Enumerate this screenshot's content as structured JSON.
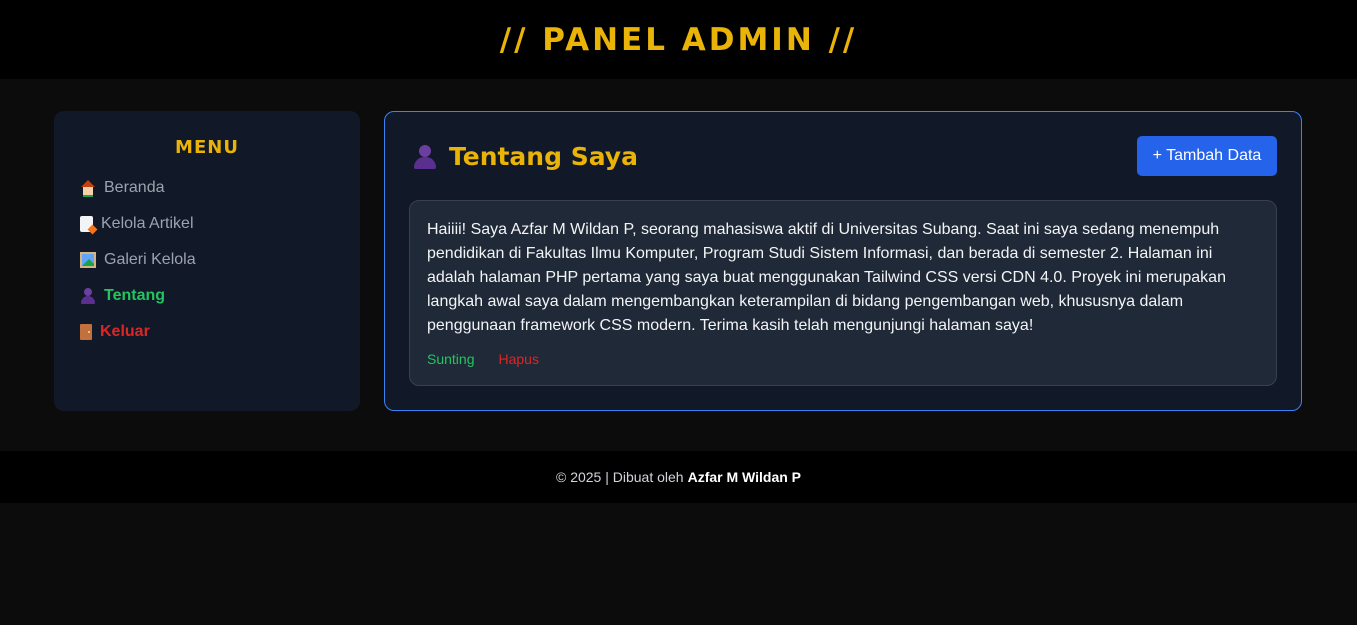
{
  "header": {
    "title": "// PANEL ADMIN //"
  },
  "sidebar": {
    "title": "MENU",
    "items": [
      {
        "icon": "house-icon",
        "label": "Beranda"
      },
      {
        "icon": "memo-icon",
        "label": "Kelola Artikel"
      },
      {
        "icon": "picture-icon",
        "label": "Galeri Kelola"
      },
      {
        "icon": "user-icon",
        "label": "Tentang",
        "active": true
      },
      {
        "icon": "door-icon",
        "label": "Keluar"
      }
    ]
  },
  "main": {
    "icon": "user-icon",
    "title": "Tentang Saya",
    "add_button": "+ Tambah Data",
    "card": {
      "text": "Haiiii! Saya Azfar M Wildan P, seorang mahasiswa aktif di Universitas Subang. Saat ini saya sedang menempuh pendidikan di Fakultas Ilmu Komputer, Program Studi Sistem Informasi, dan berada di semester 2. Halaman ini adalah halaman PHP pertama yang saya buat menggunakan Tailwind CSS versi CDN 4.0. Proyek ini merupakan langkah awal saya dalam mengembangkan keterampilan di bidang pengembangan web, khususnya dalam penggunaan framework CSS modern. Terima kasih telah mengunjungi halaman saya!",
      "edit_label": "Sunting",
      "delete_label": "Hapus"
    }
  },
  "footer": {
    "text": "© 2025 | Dibuat oleh",
    "author": "Azfar M Wildan P"
  },
  "colors": {
    "accent": "#eab308",
    "primary_button": "#2563eb",
    "active": "#22c55e",
    "danger": "#dc2626",
    "panel_border": "#3b82f6"
  }
}
